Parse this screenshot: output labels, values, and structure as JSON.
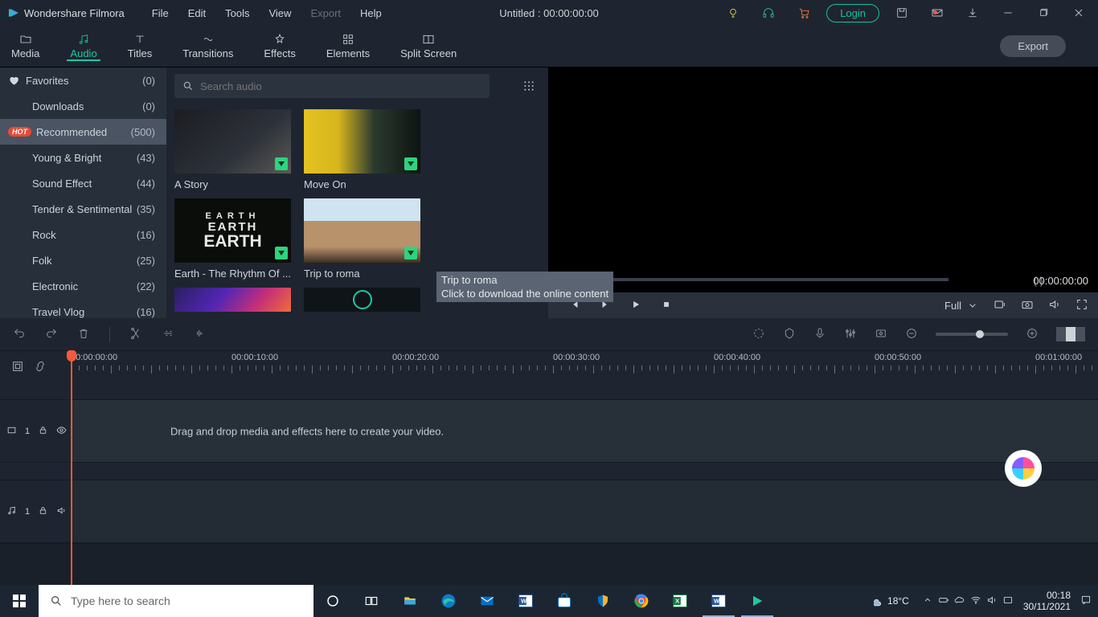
{
  "titlebar": {
    "app_name": "Wondershare Filmora",
    "menus": [
      "File",
      "Edit",
      "Tools",
      "View",
      "Export",
      "Help"
    ],
    "disabled_menu_index": 4,
    "project_title": "Untitled : 00:00:00:00",
    "login_label": "Login"
  },
  "ribbon": {
    "tabs": [
      "Media",
      "Audio",
      "Titles",
      "Transitions",
      "Effects",
      "Elements",
      "Split Screen"
    ],
    "active_index": 1,
    "export_label": "Export"
  },
  "sidebar": {
    "items": [
      {
        "label": "Favorites",
        "count": "(0)",
        "icon": "heart"
      },
      {
        "label": "Downloads",
        "count": "(0)",
        "indent": true
      },
      {
        "label": "Recommended",
        "count": "(500)",
        "badge": "HOT",
        "selected": true
      },
      {
        "label": "Young & Bright",
        "count": "(43)",
        "indent": true
      },
      {
        "label": "Sound Effect",
        "count": "(44)",
        "indent": true
      },
      {
        "label": "Tender & Sentimental",
        "count": "(35)",
        "indent": true
      },
      {
        "label": "Rock",
        "count": "(16)",
        "indent": true
      },
      {
        "label": "Folk",
        "count": "(25)",
        "indent": true
      },
      {
        "label": "Electronic",
        "count": "(22)",
        "indent": true
      },
      {
        "label": "Travel Vlog",
        "count": "(16)",
        "indent": true
      }
    ]
  },
  "search": {
    "placeholder": "Search audio"
  },
  "thumbs": [
    {
      "label": "A Story",
      "cls": "t0",
      "dl": true
    },
    {
      "label": "Move On",
      "cls": "t1",
      "dl": true
    },
    {
      "label": "Earth - The Rhythm Of ...",
      "cls": "t2",
      "dl": true,
      "earth": true
    },
    {
      "label": "Trip to roma",
      "cls": "t3",
      "dl": true
    },
    {
      "label": "",
      "cls": "t4",
      "dl": false,
      "partial": true
    },
    {
      "label": "",
      "cls": "t5",
      "dl": false,
      "partial": true,
      "ring": true
    }
  ],
  "tooltip": {
    "line1": "Trip to roma",
    "line2": "Click to download the online content"
  },
  "preview": {
    "range_markers": "{        }",
    "timecode": "00:00:00:00",
    "aspect_label": "Full"
  },
  "ruler": {
    "majors": [
      "00:00:00:00",
      "00:00:10:00",
      "00:00:20:00",
      "00:00:30:00",
      "00:00:40:00",
      "00:00:50:00",
      "00:01:00:00"
    ]
  },
  "tracks": {
    "video_label": "1",
    "audio_label": "1",
    "empty_hint": "Drag and drop media and effects here to create your video."
  },
  "taskbar": {
    "search_placeholder": "Type here to search",
    "weather_temp": "18°C",
    "time": "00:18",
    "date": "30/11/2021"
  }
}
